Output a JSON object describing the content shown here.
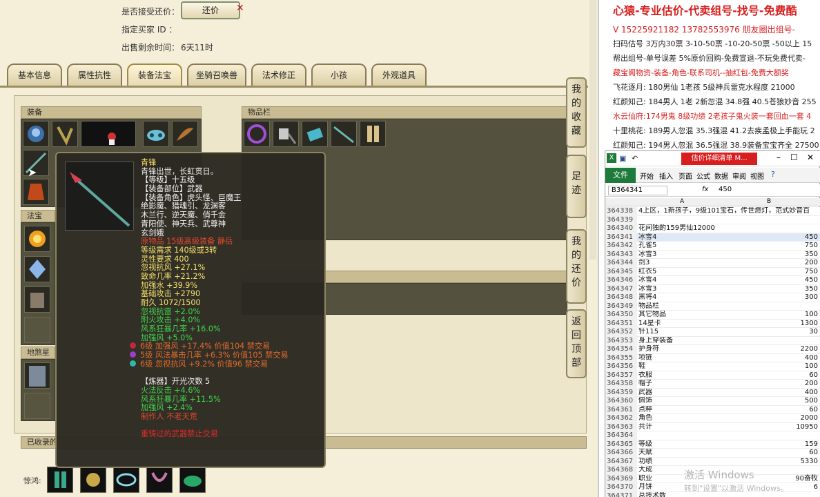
{
  "header": {
    "haggle_label": "是否接受还价：",
    "haggle_button": "还价",
    "buyer_label": "指定买家 ID ：",
    "remaining_label": "出售剩余时间：",
    "remaining_value": "6天11时"
  },
  "tabs": [
    "基本信息",
    "属性抗性",
    "装备法宝",
    "坐骑召唤兽",
    "法术修正",
    "小孩",
    "外观道具"
  ],
  "sections": {
    "equipment": "装备",
    "inventory": "物品栏",
    "treasure": "法宝",
    "earth": "地煞星用",
    "collected": "已收录的",
    "jinghong": "惊鸿:"
  },
  "side_buttons": [
    "我的收藏",
    "足迹",
    "我的还价",
    "返回顶部"
  ],
  "tooltip": {
    "lines": [
      {
        "t": "青锋",
        "c": "#ffe566"
      },
      {
        "t": "青锋出世，长虹贯日。",
        "c": "#f2f2f2"
      },
      {
        "t": "【等级】十五级",
        "c": "#f2f2f2"
      },
      {
        "t": "【装备部位】武器",
        "c": "#f2f2f2"
      },
      {
        "t": "【装备角色】虎头怪、巨魔王",
        "c": "#f2f2f2"
      },
      {
        "t": "绝影魔、猎魂引、龙渊客",
        "c": "#f2f2f2"
      },
      {
        "t": "木兰行、逆天魔、俏千金",
        "c": "#f2f2f2"
      },
      {
        "t": "青阳使、神天兵、武尊神",
        "c": "#f2f2f2"
      },
      {
        "t": "玄剑娥",
        "c": "#f2f2f2"
      },
      {
        "t": "原物品 15级高级装备 静岳",
        "c": "#e24a2e"
      },
      {
        "t": "等级需求 140级或3转",
        "c": "#f4e06a"
      },
      {
        "t": "灵性要求 400",
        "c": "#f4e06a"
      },
      {
        "t": "忽视抗风 +27.1%",
        "c": "#f4e06a"
      },
      {
        "t": "致命几率 +21.2%",
        "c": "#f4e06a"
      },
      {
        "t": "加强水 +39.9%",
        "c": "#f4e06a"
      },
      {
        "t": "基础攻击 +2790",
        "c": "#f4e06a"
      },
      {
        "t": "耐久 1072/1500",
        "c": "#f4e06a"
      },
      {
        "t": "忽视抗雷 +2.0%",
        "c": "#3fd64b"
      },
      {
        "t": "附火攻击 +4.0%",
        "c": "#3fd64b"
      },
      {
        "t": "风系狂暴几率 +16.0%",
        "c": "#3fd64b"
      },
      {
        "t": "加强风 +5.0%",
        "c": "#3fd64b"
      },
      {
        "t": "6级 加强风 +17.4% 价值104 禁交易",
        "c": "#e06a2c",
        "gem": "#c0283c"
      },
      {
        "t": "5级 风法暴击几率 +6.3% 价值105 禁交易",
        "c": "#e06a2c",
        "gem": "#a03cc8"
      },
      {
        "t": "6级 忽视抗风 +9.2% 价值96 禁交易",
        "c": "#e06a2c",
        "gem": "#30b8a8"
      },
      {
        "t": "",
        "c": "#f2f2f2"
      },
      {
        "t": "【炼器】开光次数 5",
        "c": "#f2f2f2"
      },
      {
        "t": "火法反击 +4.6%",
        "c": "#3fd64b"
      },
      {
        "t": "风系狂暴几率 +11.5%",
        "c": "#3fd64b"
      },
      {
        "t": "加强风 +2.4%",
        "c": "#3fd64b"
      },
      {
        "t": "制作人 不老天荒",
        "c": "#e24a2e"
      },
      {
        "t": "",
        "c": "#f2f2f2"
      },
      {
        "t": "重铸过的武器禁止交易",
        "c": "#e22a2a"
      }
    ]
  },
  "ad_panel": {
    "title": "心猿-专业估价-代卖组号-找号-免费酷",
    "lines": [
      {
        "t": "V 15225921182    13782553976 朋友圈出组号-",
        "c": "#d81e1e"
      },
      {
        "t": "扫码估号 3万内30票 3-10-50票 -10-20-50票 -50以上 15",
        "c": "#222"
      },
      {
        "t": "帮出组号-单号误差 5%原价回购-免费宣退-不玩免费代卖-",
        "c": "#222"
      },
      {
        "t": "藏宝阁物资-装备-角色-联系司机--抽红包-免费大额奖",
        "c": "#d81e1e"
      },
      {
        "t": "飞花逐月: 180男仙 1老孩 5级神兵雷克水程度 21000",
        "c": "#222"
      },
      {
        "t": "红颜知己: 184男人 1老 2新忽混 34.8强 40.5苍狼妙音 255",
        "c": "#222"
      },
      {
        "t": "水云仙府:174男鬼 8级功绩 2老孩子鬼火装一套回血一套 4",
        "c": "#d81e1e"
      },
      {
        "t": "十里桃花: 189男人忽混 35.3强混 41.2去疾孟极上手能玩 2",
        "c": "#222"
      },
      {
        "t": "红颜知己: 194男人忽混 36.5强混 38.9装备宝宝齐全 27500",
        "c": "#222"
      }
    ]
  },
  "excel": {
    "title": "估价详细清单 M...",
    "ribbon": [
      "文件",
      "开始",
      "插入",
      "页面",
      "公式",
      "数据",
      "审阅",
      "视图"
    ],
    "name_box": "B364341",
    "fx": "fx",
    "formula": "450",
    "col_a": "A",
    "col_b": "B",
    "rows": [
      [
        "364338",
        "4上区，1新孩子，9级101宝石，传世燃灯，范式妙音百",
        ""
      ],
      [
        "364339",
        "",
        ""
      ],
      [
        "364340",
        "花间独酌159男仙12000",
        ""
      ],
      [
        "364341",
        "冰雪4",
        "450"
      ],
      [
        "364342",
        "孔雀5",
        "750"
      ],
      [
        "364343",
        "冰雪3",
        "350"
      ],
      [
        "364344",
        "剑3",
        "200"
      ],
      [
        "364345",
        "红衣5",
        "750"
      ],
      [
        "364346",
        "冰雪4",
        "450"
      ],
      [
        "364347",
        "冰雪3",
        "350"
      ],
      [
        "364348",
        "黑将4",
        "300"
      ],
      [
        "364349",
        "物品栏",
        ""
      ],
      [
        "364350",
        "其它物品",
        "100"
      ],
      [
        "364351",
        "14星卡",
        "1300"
      ],
      [
        "364352",
        "针115",
        "30"
      ],
      [
        "364353",
        "身上穿装备",
        ""
      ],
      [
        "364354",
        "护身符",
        "2200"
      ],
      [
        "364355",
        "项链",
        "400"
      ],
      [
        "364356",
        "鞋",
        "100"
      ],
      [
        "364357",
        "衣服",
        "60"
      ],
      [
        "364358",
        "帽子",
        "200"
      ],
      [
        "364359",
        "武器",
        "400"
      ],
      [
        "364360",
        "佩饰",
        "500"
      ],
      [
        "364361",
        "点粹",
        "60"
      ],
      [
        "364362",
        "角色",
        "2000"
      ],
      [
        "364363",
        "共计",
        "10950"
      ],
      [
        "364364",
        "",
        ""
      ],
      [
        "364365",
        "等级",
        "159"
      ],
      [
        "364366",
        "天赋",
        "60"
      ],
      [
        "364367",
        "功绩",
        "5330"
      ],
      [
        "364368",
        "大成",
        ""
      ],
      [
        "364369",
        "职业",
        "90奋牧"
      ],
      [
        "364370",
        "月饼",
        "6"
      ],
      [
        "364371",
        "总技术数",
        ""
      ]
    ],
    "watermark_1": "激活 Windows",
    "watermark_2": "转到\"设置\"以激活 Windows。"
  }
}
